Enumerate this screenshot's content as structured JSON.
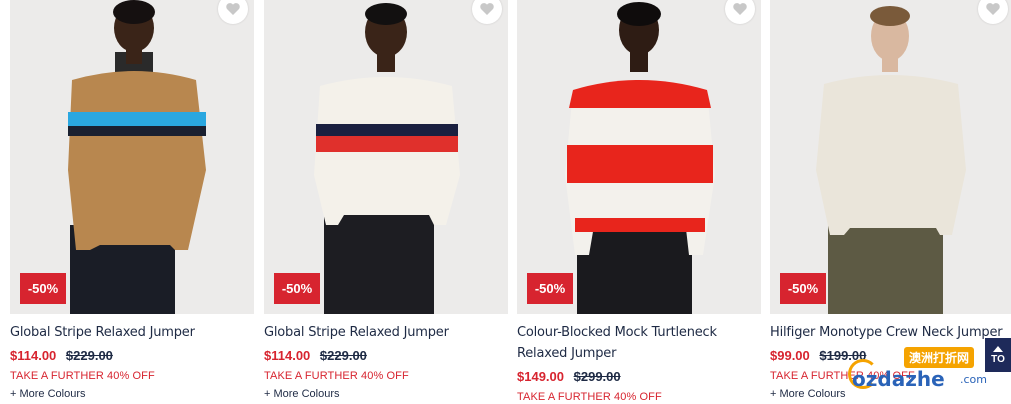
{
  "products": [
    {
      "name": "Global Stripe Relaxed Jumper",
      "price": "$114.00",
      "was": "$229.00",
      "badge": "-50%",
      "promo": "TAKE A FURTHER 40% OFF",
      "more_colours": "+ More Colours",
      "wishlist_icon": "heart-icon"
    },
    {
      "name": "Global Stripe Relaxed Jumper",
      "price": "$114.00",
      "was": "$229.00",
      "badge": "-50%",
      "promo": "TAKE A FURTHER 40% OFF",
      "more_colours": "+ More Colours",
      "wishlist_icon": "heart-icon"
    },
    {
      "name": "Colour-Blocked Mock Turtleneck Relaxed Jumper",
      "price": "$149.00",
      "was": "$299.00",
      "badge": "-50%",
      "promo": "TAKE A FURTHER 40% OFF",
      "wishlist_icon": "heart-icon"
    },
    {
      "name": "Hilfiger Monotype Crew Neck Jumper",
      "price": "$99.00",
      "was": "$199.00",
      "badge": "-50%",
      "promo": "TAKE A FURTHER 40% OFF",
      "more_colours": "+ More Colours",
      "wishlist_icon": "heart-icon"
    }
  ],
  "back_to_top": "TO",
  "watermark": {
    "cn_text": "澳洲打折网",
    "logo": "ozdazhe",
    "suffix": ".com"
  },
  "colors": {
    "sale_red": "#d7242f",
    "text_navy": "#1e2a44",
    "image_bg": "#ecebea"
  }
}
